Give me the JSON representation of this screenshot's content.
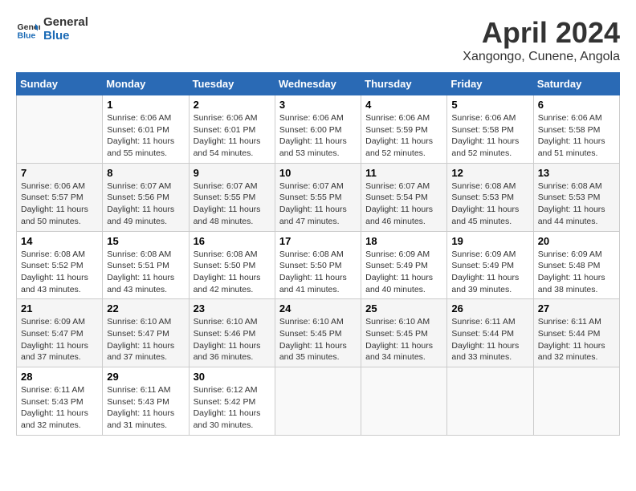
{
  "header": {
    "logo_line1": "General",
    "logo_line2": "Blue",
    "title": "April 2024",
    "subtitle": "Xangongo, Cunene, Angola"
  },
  "weekdays": [
    "Sunday",
    "Monday",
    "Tuesday",
    "Wednesday",
    "Thursday",
    "Friday",
    "Saturday"
  ],
  "weeks": [
    [
      {
        "day": "",
        "sunrise": "",
        "sunset": "",
        "daylight": ""
      },
      {
        "day": "1",
        "sunrise": "Sunrise: 6:06 AM",
        "sunset": "Sunset: 6:01 PM",
        "daylight": "Daylight: 11 hours and 55 minutes."
      },
      {
        "day": "2",
        "sunrise": "Sunrise: 6:06 AM",
        "sunset": "Sunset: 6:01 PM",
        "daylight": "Daylight: 11 hours and 54 minutes."
      },
      {
        "day": "3",
        "sunrise": "Sunrise: 6:06 AM",
        "sunset": "Sunset: 6:00 PM",
        "daylight": "Daylight: 11 hours and 53 minutes."
      },
      {
        "day": "4",
        "sunrise": "Sunrise: 6:06 AM",
        "sunset": "Sunset: 5:59 PM",
        "daylight": "Daylight: 11 hours and 52 minutes."
      },
      {
        "day": "5",
        "sunrise": "Sunrise: 6:06 AM",
        "sunset": "Sunset: 5:58 PM",
        "daylight": "Daylight: 11 hours and 52 minutes."
      },
      {
        "day": "6",
        "sunrise": "Sunrise: 6:06 AM",
        "sunset": "Sunset: 5:58 PM",
        "daylight": "Daylight: 11 hours and 51 minutes."
      }
    ],
    [
      {
        "day": "7",
        "sunrise": "Sunrise: 6:06 AM",
        "sunset": "Sunset: 5:57 PM",
        "daylight": "Daylight: 11 hours and 50 minutes."
      },
      {
        "day": "8",
        "sunrise": "Sunrise: 6:07 AM",
        "sunset": "Sunset: 5:56 PM",
        "daylight": "Daylight: 11 hours and 49 minutes."
      },
      {
        "day": "9",
        "sunrise": "Sunrise: 6:07 AM",
        "sunset": "Sunset: 5:55 PM",
        "daylight": "Daylight: 11 hours and 48 minutes."
      },
      {
        "day": "10",
        "sunrise": "Sunrise: 6:07 AM",
        "sunset": "Sunset: 5:55 PM",
        "daylight": "Daylight: 11 hours and 47 minutes."
      },
      {
        "day": "11",
        "sunrise": "Sunrise: 6:07 AM",
        "sunset": "Sunset: 5:54 PM",
        "daylight": "Daylight: 11 hours and 46 minutes."
      },
      {
        "day": "12",
        "sunrise": "Sunrise: 6:08 AM",
        "sunset": "Sunset: 5:53 PM",
        "daylight": "Daylight: 11 hours and 45 minutes."
      },
      {
        "day": "13",
        "sunrise": "Sunrise: 6:08 AM",
        "sunset": "Sunset: 5:53 PM",
        "daylight": "Daylight: 11 hours and 44 minutes."
      }
    ],
    [
      {
        "day": "14",
        "sunrise": "Sunrise: 6:08 AM",
        "sunset": "Sunset: 5:52 PM",
        "daylight": "Daylight: 11 hours and 43 minutes."
      },
      {
        "day": "15",
        "sunrise": "Sunrise: 6:08 AM",
        "sunset": "Sunset: 5:51 PM",
        "daylight": "Daylight: 11 hours and 43 minutes."
      },
      {
        "day": "16",
        "sunrise": "Sunrise: 6:08 AM",
        "sunset": "Sunset: 5:50 PM",
        "daylight": "Daylight: 11 hours and 42 minutes."
      },
      {
        "day": "17",
        "sunrise": "Sunrise: 6:08 AM",
        "sunset": "Sunset: 5:50 PM",
        "daylight": "Daylight: 11 hours and 41 minutes."
      },
      {
        "day": "18",
        "sunrise": "Sunrise: 6:09 AM",
        "sunset": "Sunset: 5:49 PM",
        "daylight": "Daylight: 11 hours and 40 minutes."
      },
      {
        "day": "19",
        "sunrise": "Sunrise: 6:09 AM",
        "sunset": "Sunset: 5:49 PM",
        "daylight": "Daylight: 11 hours and 39 minutes."
      },
      {
        "day": "20",
        "sunrise": "Sunrise: 6:09 AM",
        "sunset": "Sunset: 5:48 PM",
        "daylight": "Daylight: 11 hours and 38 minutes."
      }
    ],
    [
      {
        "day": "21",
        "sunrise": "Sunrise: 6:09 AM",
        "sunset": "Sunset: 5:47 PM",
        "daylight": "Daylight: 11 hours and 37 minutes."
      },
      {
        "day": "22",
        "sunrise": "Sunrise: 6:10 AM",
        "sunset": "Sunset: 5:47 PM",
        "daylight": "Daylight: 11 hours and 37 minutes."
      },
      {
        "day": "23",
        "sunrise": "Sunrise: 6:10 AM",
        "sunset": "Sunset: 5:46 PM",
        "daylight": "Daylight: 11 hours and 36 minutes."
      },
      {
        "day": "24",
        "sunrise": "Sunrise: 6:10 AM",
        "sunset": "Sunset: 5:45 PM",
        "daylight": "Daylight: 11 hours and 35 minutes."
      },
      {
        "day": "25",
        "sunrise": "Sunrise: 6:10 AM",
        "sunset": "Sunset: 5:45 PM",
        "daylight": "Daylight: 11 hours and 34 minutes."
      },
      {
        "day": "26",
        "sunrise": "Sunrise: 6:11 AM",
        "sunset": "Sunset: 5:44 PM",
        "daylight": "Daylight: 11 hours and 33 minutes."
      },
      {
        "day": "27",
        "sunrise": "Sunrise: 6:11 AM",
        "sunset": "Sunset: 5:44 PM",
        "daylight": "Daylight: 11 hours and 32 minutes."
      }
    ],
    [
      {
        "day": "28",
        "sunrise": "Sunrise: 6:11 AM",
        "sunset": "Sunset: 5:43 PM",
        "daylight": "Daylight: 11 hours and 32 minutes."
      },
      {
        "day": "29",
        "sunrise": "Sunrise: 6:11 AM",
        "sunset": "Sunset: 5:43 PM",
        "daylight": "Daylight: 11 hours and 31 minutes."
      },
      {
        "day": "30",
        "sunrise": "Sunrise: 6:12 AM",
        "sunset": "Sunset: 5:42 PM",
        "daylight": "Daylight: 11 hours and 30 minutes."
      },
      {
        "day": "",
        "sunrise": "",
        "sunset": "",
        "daylight": ""
      },
      {
        "day": "",
        "sunrise": "",
        "sunset": "",
        "daylight": ""
      },
      {
        "day": "",
        "sunrise": "",
        "sunset": "",
        "daylight": ""
      },
      {
        "day": "",
        "sunrise": "",
        "sunset": "",
        "daylight": ""
      }
    ]
  ]
}
